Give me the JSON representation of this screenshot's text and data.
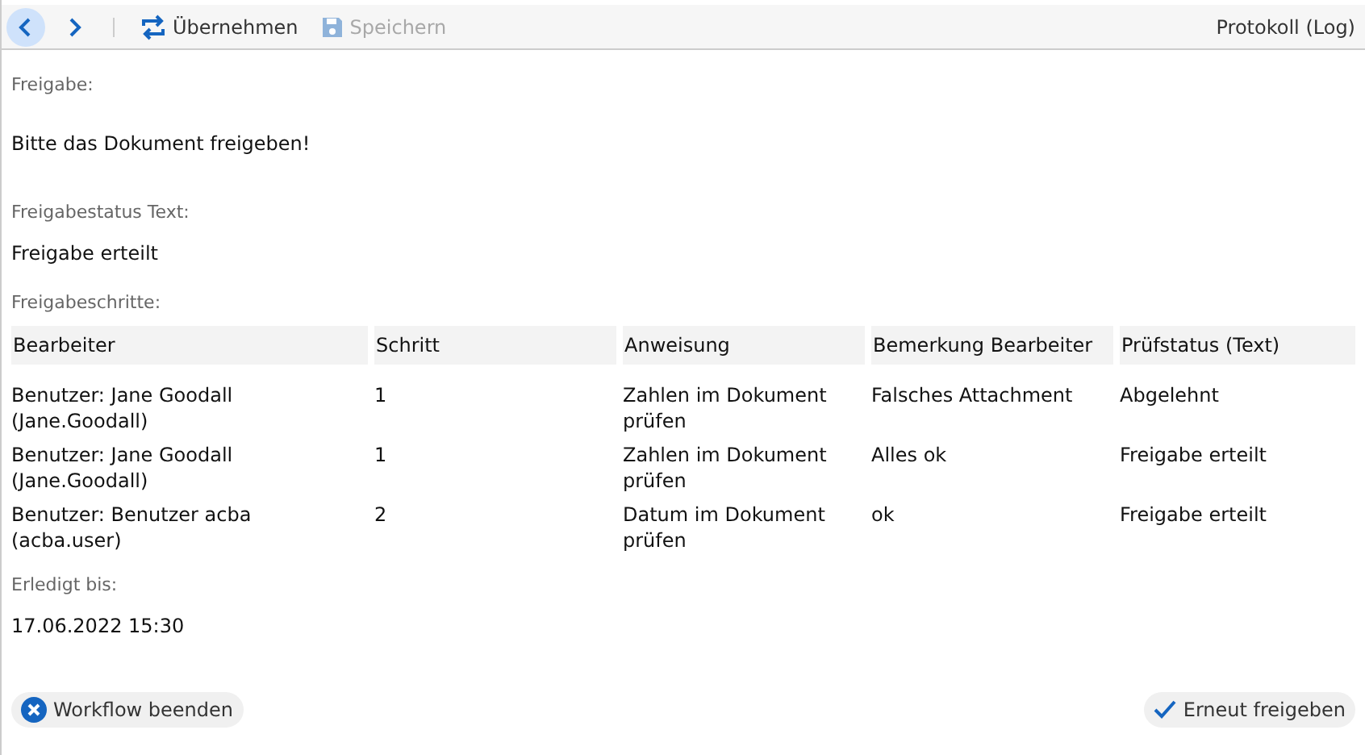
{
  "toolbar": {
    "buttons": [
      {
        "kind": "back",
        "selected": true
      },
      {
        "kind": "forward",
        "selected": false
      },
      {
        "kind": "apply",
        "label": "Übernehmen",
        "disabled": false
      },
      {
        "kind": "save",
        "label": "Speichern",
        "disabled": true
      }
    ],
    "log_link": "Protokoll (Log)"
  },
  "fields": [
    {
      "label": "Freigabe:",
      "value": "Bitte das Dokument freigeben!"
    },
    {
      "label": "Freigabestatus Text:",
      "value": "Freigabe erteilt"
    }
  ],
  "steps": {
    "label": "Freigabeschritte:",
    "columns": [
      "Bearbeiter",
      "Schritt",
      "Anweisung",
      "Bemerkung Bearbeiter",
      "Prüfstatus (Text)"
    ],
    "rows": [
      [
        "Benutzer: Jane Goodall (Jane.Goodall)",
        "1",
        "Zahlen im Dokument prüfen",
        "Falsches Attachment",
        "Abgelehnt"
      ],
      [
        "Benutzer: Jane Goodall (Jane.Goodall)",
        "1",
        "Zahlen im Dokument prüfen",
        "Alles ok",
        "Freigabe erteilt"
      ],
      [
        "Benutzer: Benutzer acba (acba.user)",
        "2",
        "Datum im Dokument prüfen",
        "ok",
        "Freigabe erteilt"
      ]
    ]
  },
  "due": {
    "label": "Erledigt bis:",
    "value": "17.06.2022 15:30"
  },
  "actions": [
    {
      "kind": "cancel",
      "label": "Workflow beenden"
    },
    {
      "kind": "approve",
      "label": "Erneut freigeben"
    }
  ]
}
